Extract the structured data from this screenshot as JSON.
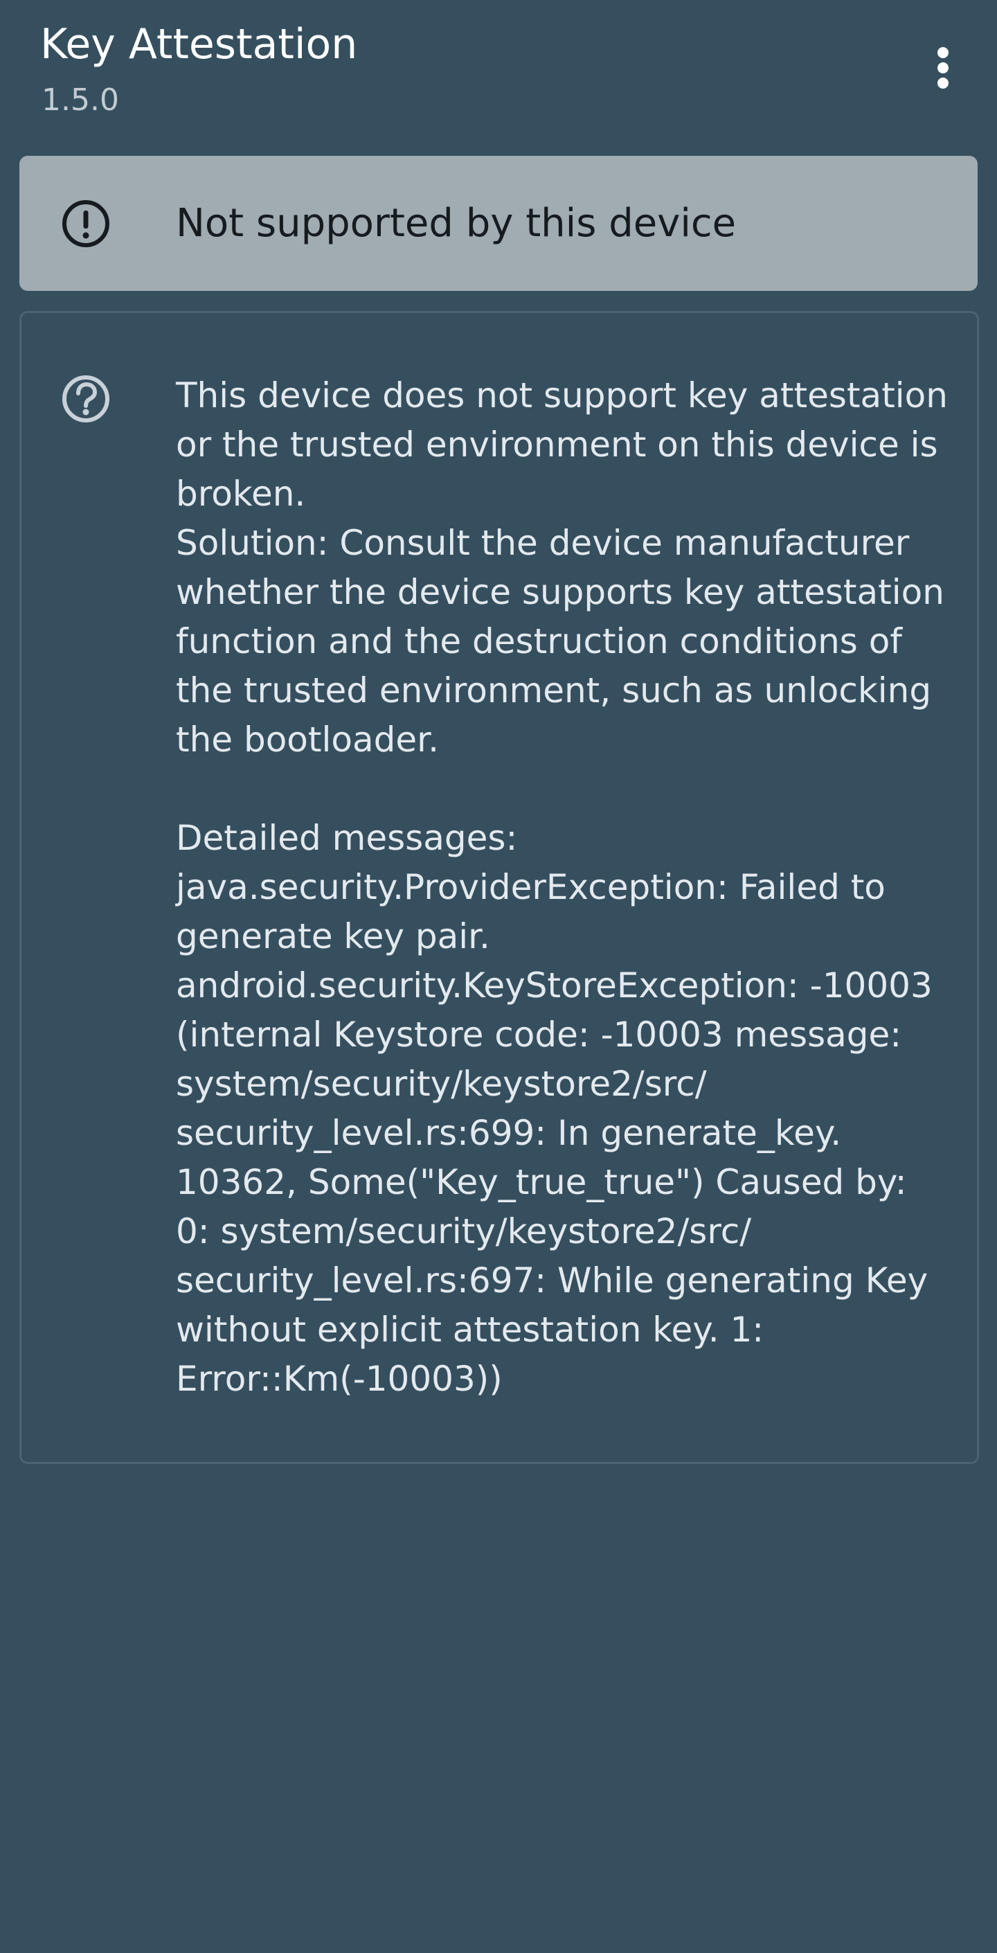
{
  "app": {
    "title": "Key Attestation",
    "version": "1.5.0"
  },
  "toolbar": {
    "overflow_icon": "more-vert-icon"
  },
  "status": {
    "icon": "error-outline-icon",
    "message": "Not supported by this device"
  },
  "details": {
    "icon": "help-outline-icon",
    "text": "This device does not support key attestation or the trusted environment on this device is broken.\nSolution: Consult the device manufacturer whether the device supports key attestation function and the destruction conditions of the trusted environment, such as unlocking the bootloader.\n\nDetailed messages:\njava.security.ProviderException: Failed to generate key pair.\nandroid.security.KeyStoreException: -10003 (internal Keystore code: -10003 message: system/security/keystore2/src/ security_level.rs:699: In generate_key. 10362, Some(\"Key_true_true\") Caused by: 0: system/security/keystore2/src/ security_level.rs:697: While generating Key without explicit attestation key. 1: Error::Km(-10003))"
  },
  "colors": {
    "background": "#364f5f",
    "status_card": "#a1abb2",
    "detail_border": "#4b6372",
    "primary_text": "#ffffff",
    "body_text": "#e3e9ee"
  }
}
